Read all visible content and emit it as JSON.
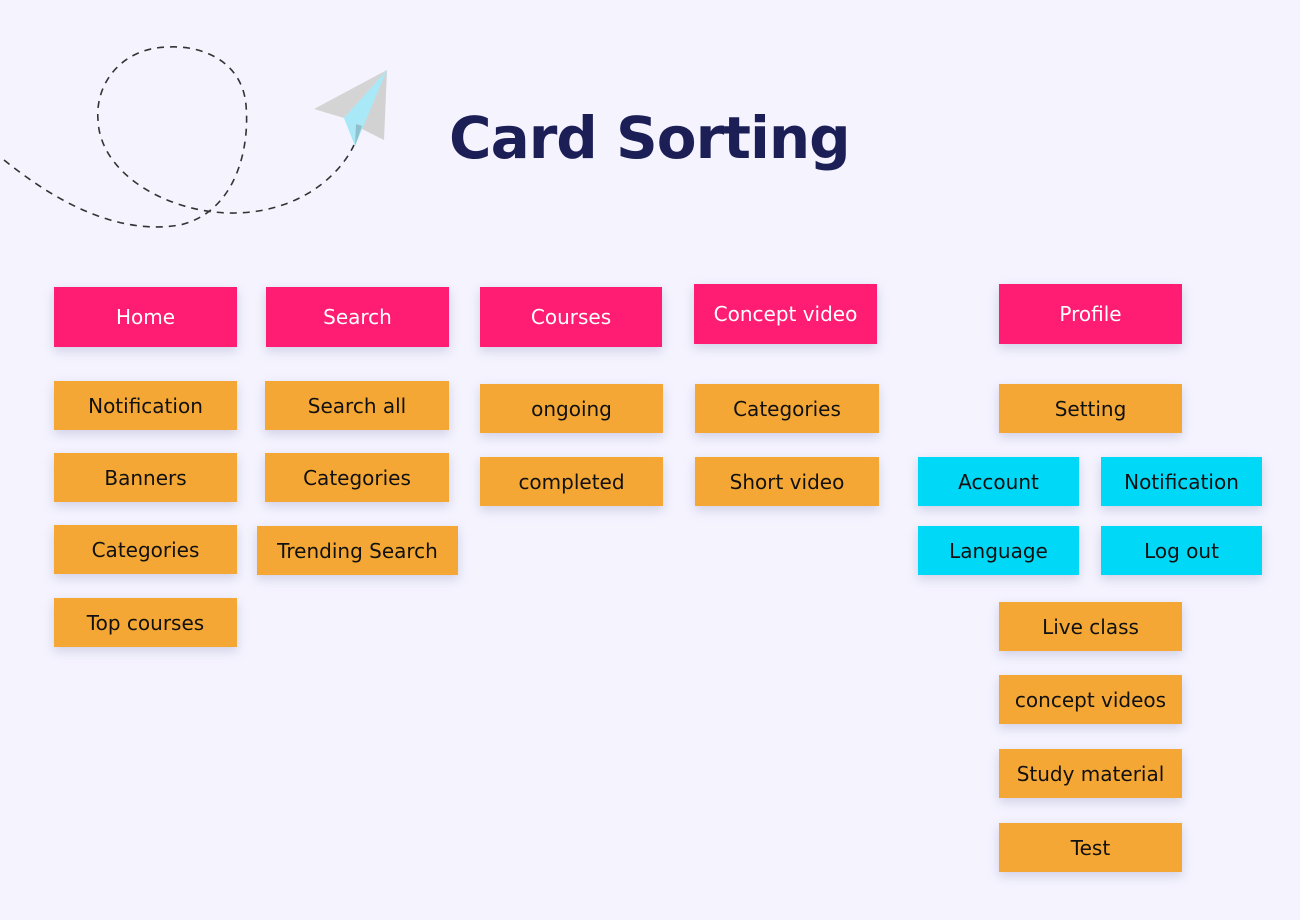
{
  "title": "Card Sorting",
  "colors": {
    "background": "#f4f3fe",
    "title": "#1c1f56",
    "category_card": "#ff1d74",
    "item_card": "#f4a734",
    "sub_item_card": "#00d8f8"
  },
  "decoration": {
    "icon": "paper-plane-icon",
    "path_style": "dashed-loop"
  },
  "columns": [
    {
      "category": "Home",
      "items": [
        "Notification",
        "Banners",
        "Categories",
        "Top courses"
      ]
    },
    {
      "category": "Search",
      "items": [
        "Search all",
        "Categories",
        "Trending Search"
      ]
    },
    {
      "category": "Courses",
      "items": [
        "ongoing",
        "completed"
      ]
    },
    {
      "category": "Concept video",
      "items": [
        "Categories",
        "Short video"
      ]
    },
    {
      "category": "Profile",
      "items": [
        "Setting"
      ],
      "setting_sub_items": [
        "Account",
        "Notification",
        "Language",
        "Log out"
      ],
      "more_items": [
        "Live class",
        "concept videos",
        "Study material",
        "Test"
      ]
    }
  ]
}
